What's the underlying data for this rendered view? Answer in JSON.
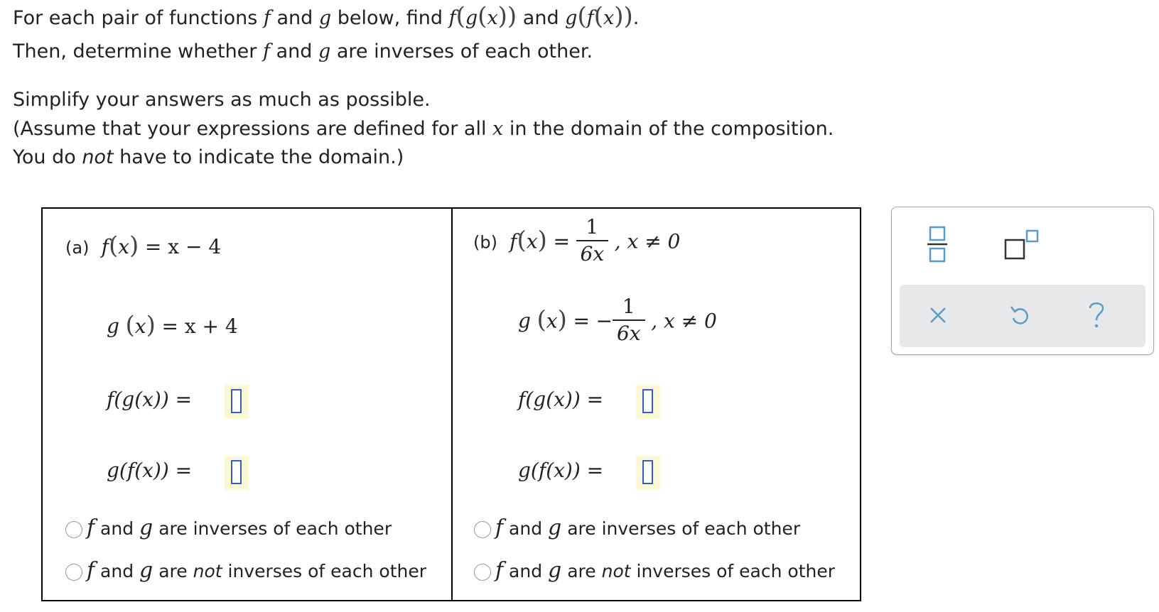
{
  "instructions": {
    "line1": {
      "t1": "For each pair of functions ",
      "f": "f",
      "t2": " and ",
      "g": "g",
      "t3": " below, find ",
      "comp1": {
        "outer": "f",
        "open": "(",
        "inner_g": "g",
        "open2": "(",
        "x": "x",
        "close": "))"
      },
      "t4": " and ",
      "comp2": {
        "outer": "g",
        "open": "(",
        "inner_f": "f",
        "open2": "(",
        "x": "x",
        "close": "))"
      },
      "t5": "."
    },
    "line2": {
      "t1": "Then, determine whether ",
      "f": "f",
      "t2": " and ",
      "g": "g",
      "t3": " are inverses of each other."
    },
    "line3": "Simplify your answers as much as possible.",
    "line4": {
      "t1": "(Assume that your expressions are defined for all ",
      "x": "x",
      "t2": " in the domain of the composition."
    },
    "line5": {
      "t1": "You do ",
      "not": "not",
      "t2": " have to indicate the domain.)"
    }
  },
  "part_a": {
    "label": "(a)",
    "f_def": {
      "name": "f",
      "x": "x",
      "rhs": "= x − 4"
    },
    "g_def": {
      "name": "g",
      "x": "x",
      "rhs": "= x + 4"
    },
    "fg_label": "f(g(x)) =",
    "gf_label": "g(f(x)) =",
    "choice1": {
      "f": "f",
      "and": " and ",
      "g": "g",
      "rest": " are inverses of each other"
    },
    "choice2": {
      "f": "f",
      "and": " and ",
      "g": "g",
      "rest1": " are ",
      "not": "not",
      "rest2": " inverses of each other"
    }
  },
  "part_b": {
    "label": "(b)",
    "f_def": {
      "name": "f",
      "x": "x",
      "eq": "=",
      "num": "1",
      "den": "6x",
      "cond": ",   x ≠ 0"
    },
    "g_def": {
      "name": "g",
      "x": "x",
      "eq": "=",
      "sign": "−",
      "num": "1",
      "den": "6x",
      "cond": ",   x ≠ 0"
    },
    "fg_label": "f(g(x)) =",
    "gf_label": "g(f(x)) =",
    "choice1": {
      "f": "f",
      "and": " and ",
      "g": "g",
      "rest": " are inverses of each other"
    },
    "choice2": {
      "f": "f",
      "and": " and ",
      "g": "g",
      "rest1": " are ",
      "not": "not",
      "rest2": " inverses of each other"
    }
  },
  "palette": {
    "tools": [
      "fraction-icon",
      "exponent-icon",
      "clear-icon",
      "undo-icon",
      "help-icon"
    ],
    "help_glyph": "?",
    "clear_glyph": "×"
  },
  "colors": {
    "answer_border": "#3a57d6",
    "answer_bg": "#fcf8d4",
    "palette_border": "#9aa9b6",
    "palette_bottom_bg": "#e6e8ea",
    "tool_blue": "#5b9bc4"
  }
}
